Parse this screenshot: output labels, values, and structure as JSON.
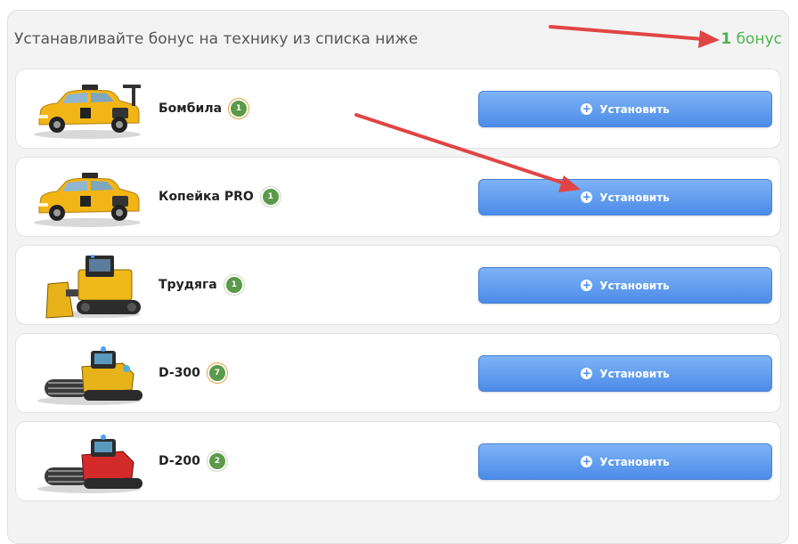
{
  "header": {
    "text": "Устанавливайте бонус на технику из списка ниже",
    "bonus_count": "1",
    "bonus_label": "бонус"
  },
  "colors": {
    "button": "#4c8be8",
    "bonus_text": "#4fb34f",
    "arrow": "#e04545",
    "level_badge": "#5a9a4a"
  },
  "vehicles": [
    {
      "name": "Бомбила",
      "level": "1",
      "icon": "yellow-taxi-car",
      "button_label": "Установить"
    },
    {
      "name": "Копейка PRO",
      "level": "1",
      "icon": "yellow-taxi-car",
      "button_label": "Установить"
    },
    {
      "name": "Трудяга",
      "level": "1",
      "icon": "yellow-bulldozer",
      "button_label": "Установить"
    },
    {
      "name": "D-300",
      "level": "7",
      "icon": "yellow-harvester",
      "button_label": "Установить"
    },
    {
      "name": "D-200",
      "level": "2",
      "icon": "red-harvester",
      "button_label": "Установить"
    }
  ]
}
